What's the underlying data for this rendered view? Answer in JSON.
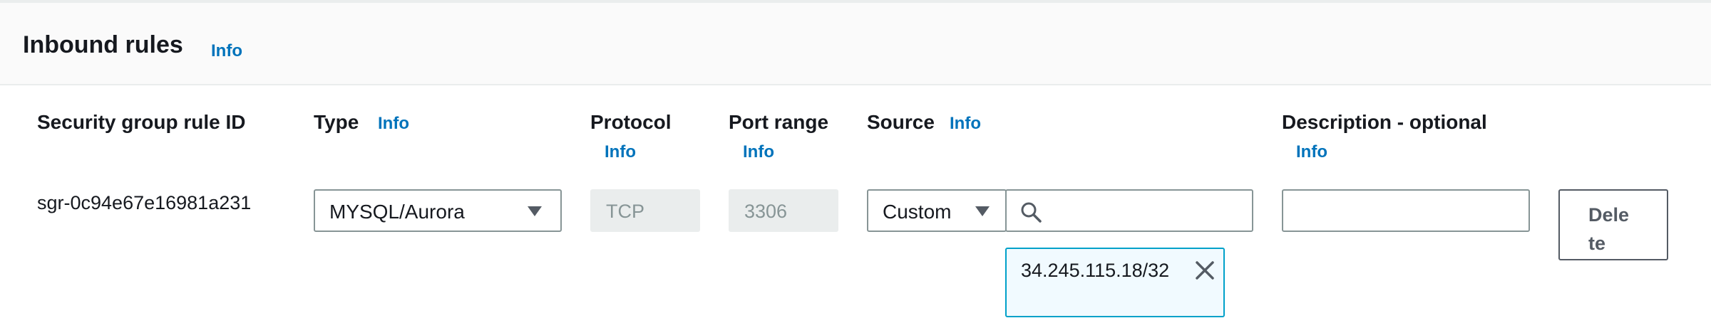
{
  "header": {
    "title": "Inbound rules",
    "info_label": "Info"
  },
  "columns": {
    "rule_id": {
      "label": "Security group rule ID"
    },
    "type": {
      "label": "Type",
      "info_label": "Info"
    },
    "protocol": {
      "label": "Protocol",
      "info_label": "Info"
    },
    "port_range": {
      "label": "Port range",
      "info_label": "Info"
    },
    "source": {
      "label": "Source",
      "info_label": "Info"
    },
    "description": {
      "label": "Description - optional",
      "info_label": "Info"
    }
  },
  "rule": {
    "id": "sgr-0c94e67e16981a231",
    "type_value": "MYSQL/Aurora",
    "protocol_value": "TCP",
    "port_range_value": "3306",
    "source_type_value": "Custom",
    "source_search_value": "",
    "source_token": "34.245.115.18/32",
    "description_value": "",
    "delete_label": "Delete"
  },
  "icons": {
    "type_caret": "caret-down-icon",
    "source_caret": "caret-down-icon",
    "search": "search-icon",
    "token_remove": "close-icon"
  },
  "colors": {
    "link": "#0073bb",
    "token_border": "#00a1c9",
    "token_background": "#f1faff",
    "input_border": "#879596",
    "disabled_background": "#eaeded"
  }
}
